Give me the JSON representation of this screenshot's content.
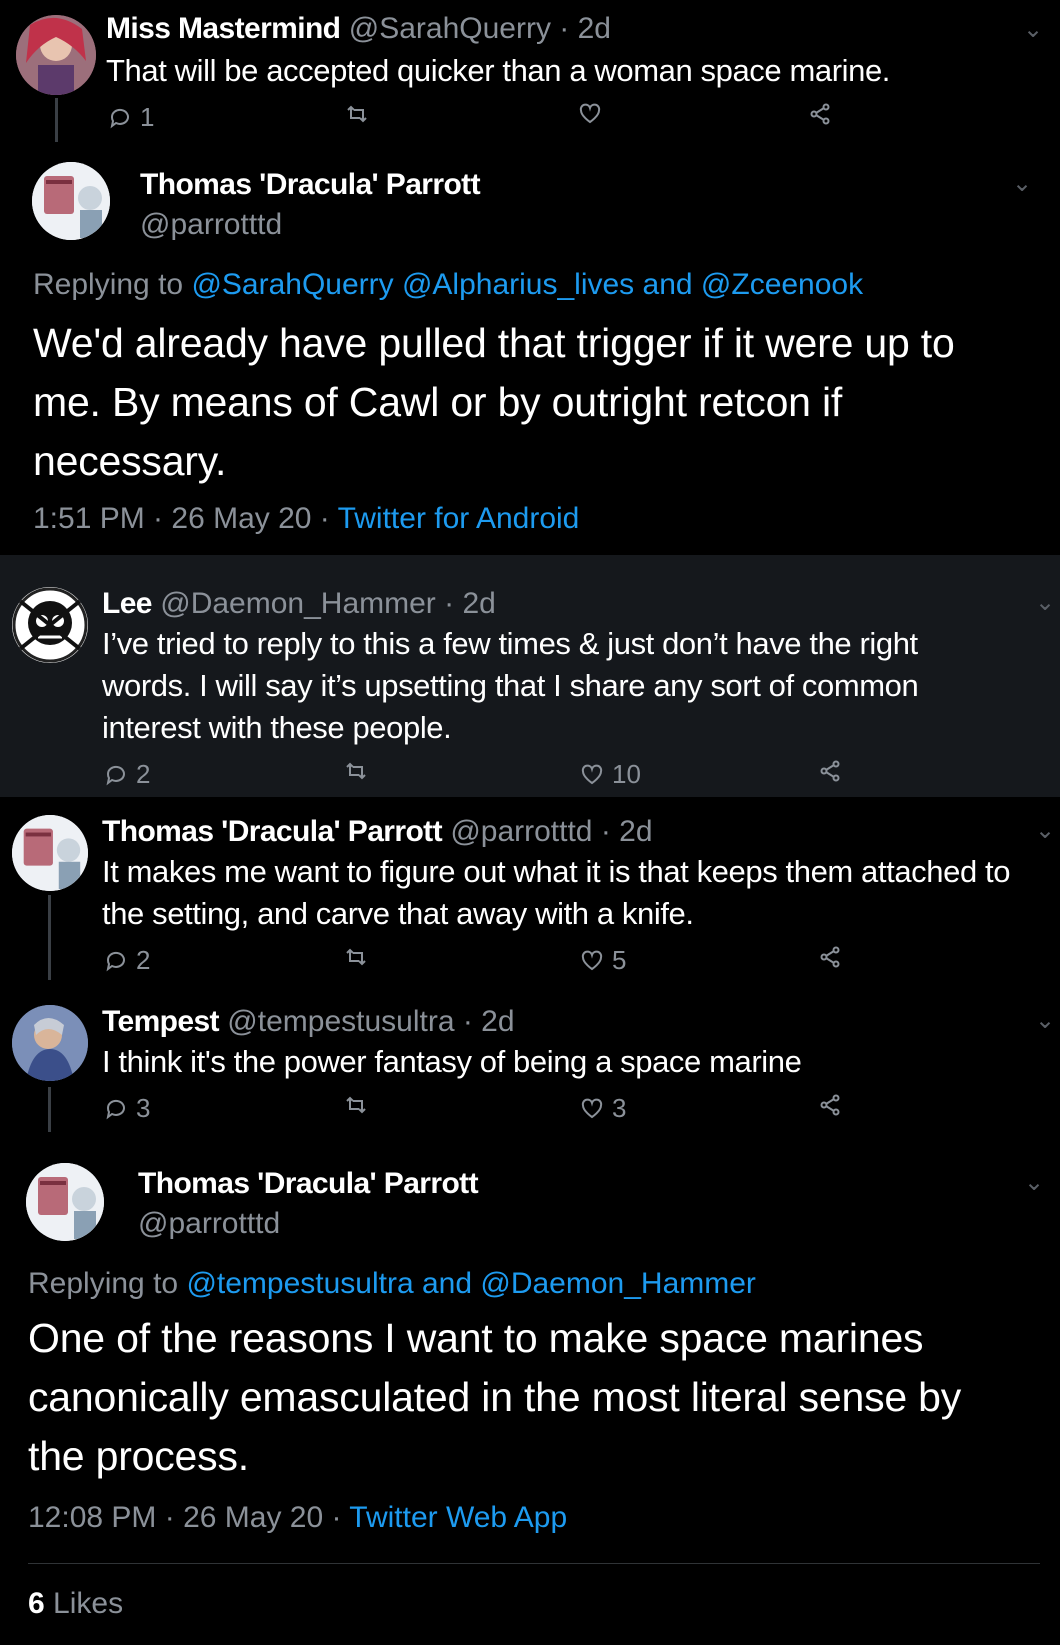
{
  "tweets": [
    {
      "name": "Miss Mastermind",
      "handle": "@SarahQuerry",
      "time": "· 2d",
      "text": "That will be accepted quicker than a woman space marine.",
      "replies": "1",
      "retweets": "",
      "likes": ""
    },
    {
      "name": "Lee",
      "handle": "@Daemon_Hammer",
      "time": "· 2d",
      "text": "I’ve tried to reply to this a few times & just don’t have the right words. I will say it’s upsetting that I share any sort of common interest with these people.",
      "replies": "2",
      "retweets": "",
      "likes": "10"
    },
    {
      "name": "Thomas 'Dracula' Parrott",
      "handle": "@parrotttd",
      "time": "· 2d",
      "text": "It makes me want to figure out what it is that keeps them attached to the setting, and carve that away with a knife.",
      "replies": "2",
      "retweets": "",
      "likes": "5"
    },
    {
      "name": "Tempest",
      "handle": "@tempestusultra",
      "time": "· 2d",
      "text": "I think it's the power fantasy of being a space marine",
      "replies": "3",
      "retweets": "",
      "likes": "3"
    }
  ],
  "focus1": {
    "name": "Thomas 'Dracula' Parrott",
    "handle": "@parrotttd",
    "replying_prefix": "Replying to ",
    "replying_to": "@SarahQuerry @Alpharius_lives and @Zceenook",
    "text": "We'd already have pulled that trigger if it were up to me. By means of Cawl or by outright retcon if necessary.",
    "timestamp": "1:51 PM · 26 May 20 · ",
    "source": "Twitter for Android"
  },
  "focus2": {
    "name": "Thomas 'Dracula' Parrott",
    "handle": "@parrotttd",
    "replying_prefix": "Replying to ",
    "replying_to": "@tempestusultra and @Daemon_Hammer",
    "text": "One of the reasons I want to make space marines canonically emasculated in the most literal sense by the process.",
    "timestamp": "12:08 PM · 26 May 20 · ",
    "source": "Twitter Web App",
    "likes_count": "6",
    "likes_label": "Likes"
  },
  "icons": {
    "reply": "reply-icon",
    "retweet": "retweet-icon",
    "like": "heart-icon",
    "share": "share-icon",
    "menu": "chevron-down-icon"
  },
  "colors": {
    "background": "#000000",
    "highlight_background": "#15181c",
    "link": "#1d9bf0",
    "muted": "#8b9199"
  }
}
